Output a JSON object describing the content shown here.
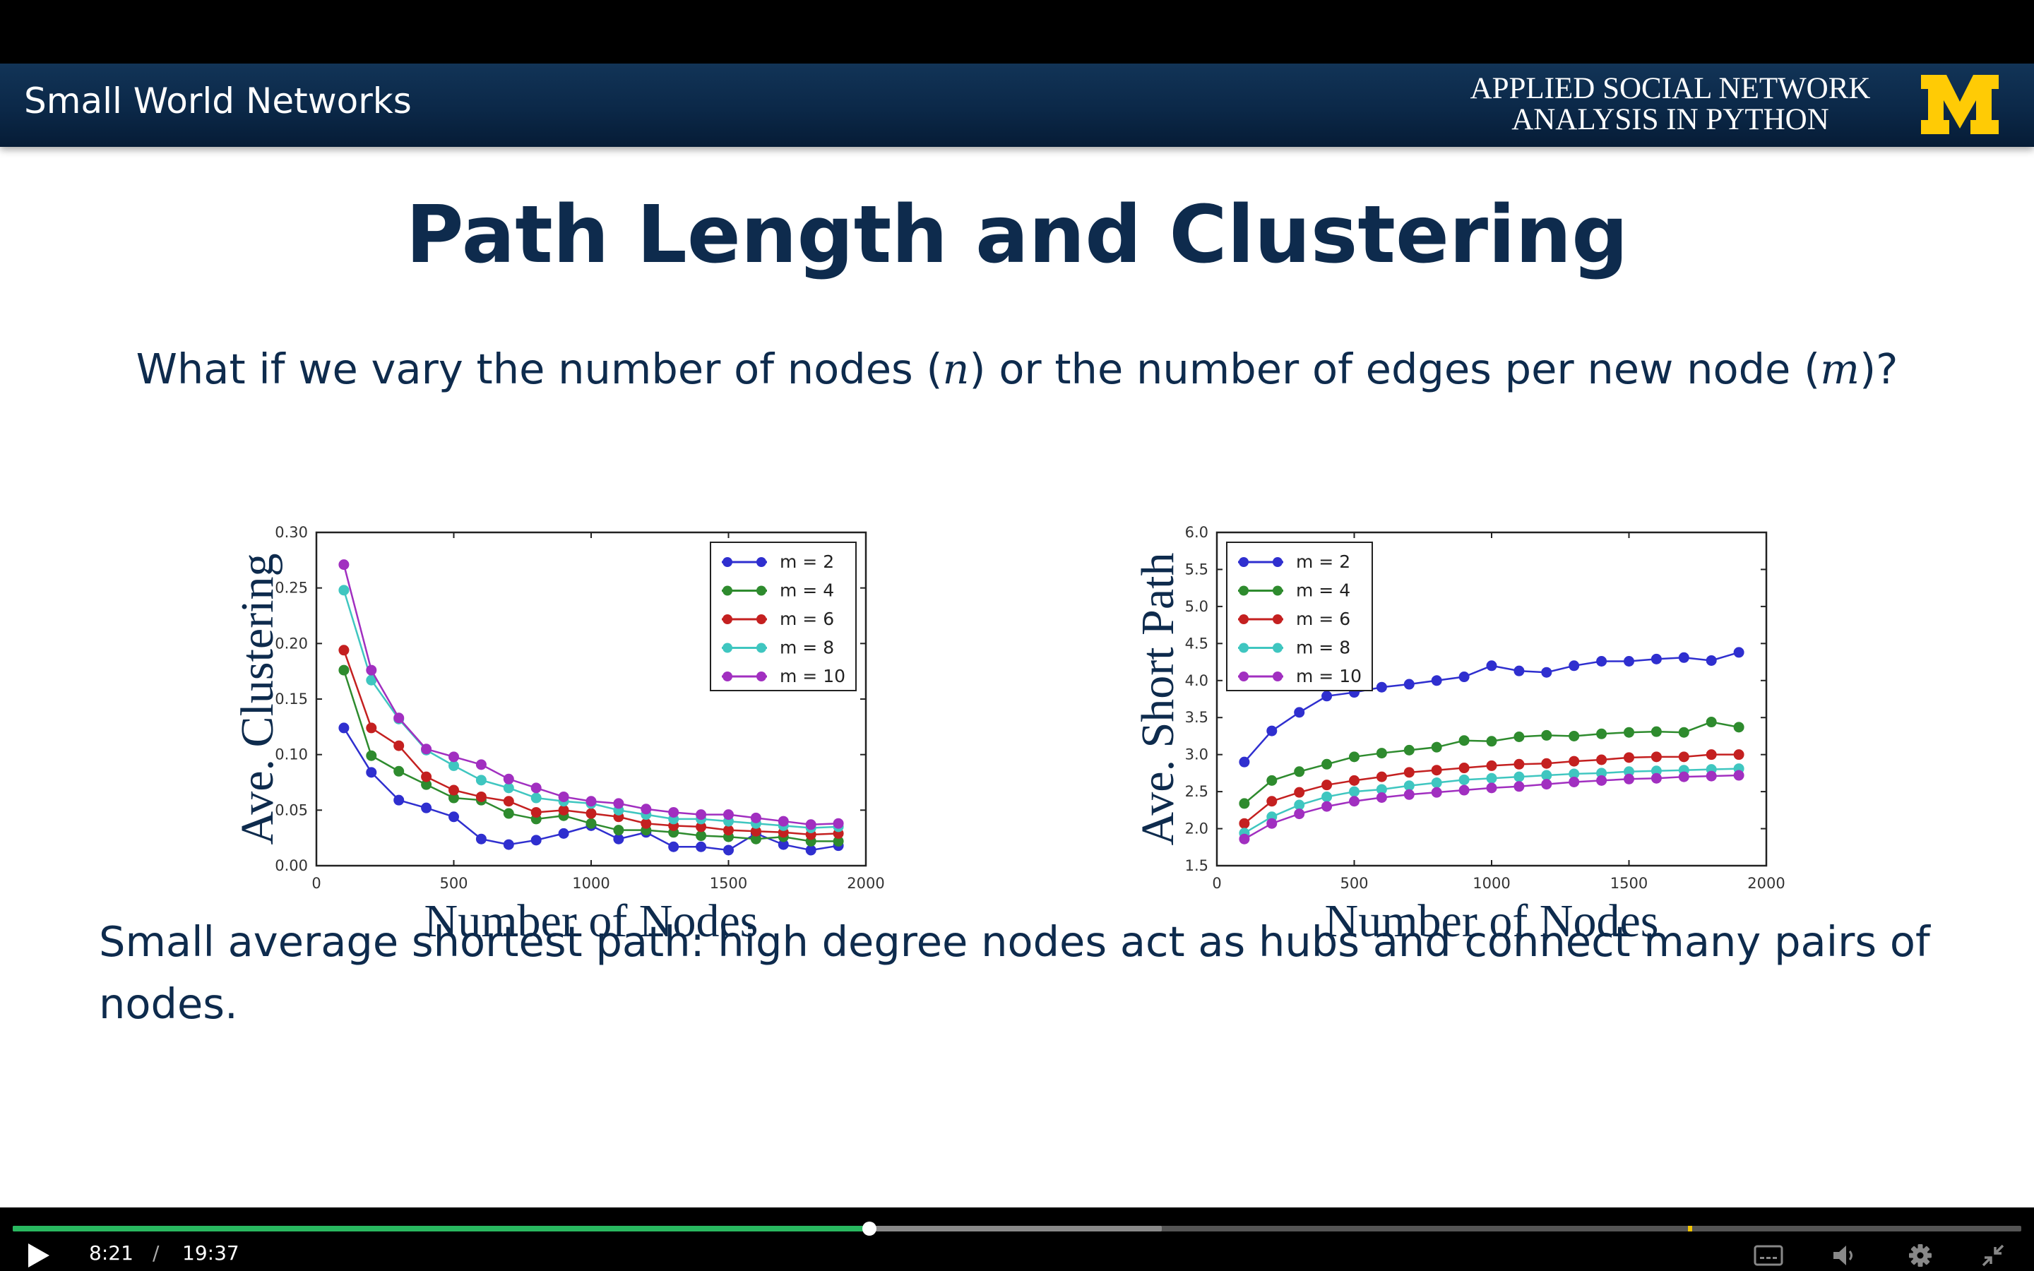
{
  "header": {
    "section_title": "Small World Networks",
    "course_line1": "APPLIED SOCIAL NETWORK",
    "course_line2": "ANALYSIS IN PYTHON",
    "logo": "block-m-logo"
  },
  "slide": {
    "title": "Path Length and Clustering",
    "question_part1": "What if we vary the number of nodes (",
    "question_var_n": "n",
    "question_part2": ") or the number of edges per new node (",
    "question_var_m": "m",
    "question_part3": ")?",
    "conclusion": "Small average shortest path: high degree nodes act as hubs and connect many pairs of nodes."
  },
  "player": {
    "current_time": "8:21",
    "separator": "/",
    "duration": "19:37",
    "progress_fraction": 0.4264,
    "buffered_fraction": 0.572,
    "marker_fraction": 0.834,
    "icons": [
      "play-icon",
      "captions-icon",
      "volume-icon",
      "settings-icon",
      "exit-fullscreen-icon"
    ]
  },
  "colors": {
    "header_bg": "#0b2848",
    "title_text": "#0e2b4d",
    "logo_yellow": "#ffcb05",
    "progress_played": "#29b860",
    "progress_marker": "#f4c500"
  },
  "chart_data": [
    {
      "type": "line",
      "xlabel": "Number of Nodes",
      "ylabel": "Ave. Clustering",
      "xlim": [
        0,
        2000
      ],
      "ylim": [
        0,
        0.3
      ],
      "xticks": [
        "0",
        "500",
        "1000",
        "1500",
        "2000"
      ],
      "yticks": [
        "0.00",
        "0.05",
        "0.10",
        "0.15",
        "0.20",
        "0.25",
        "0.30"
      ],
      "legend_position": "top-right",
      "x": [
        100,
        200,
        300,
        400,
        500,
        600,
        700,
        800,
        900,
        1000,
        1100,
        1200,
        1300,
        1400,
        1500,
        1600,
        1700,
        1800,
        1900
      ],
      "series": [
        {
          "name": "m = 2",
          "color": "#2f2fcf",
          "values": [
            0.124,
            0.084,
            0.059,
            0.052,
            0.044,
            0.024,
            0.019,
            0.023,
            0.029,
            0.036,
            0.024,
            0.03,
            0.017,
            0.017,
            0.014,
            0.029,
            0.019,
            0.014,
            0.018
          ]
        },
        {
          "name": "m = 4",
          "color": "#2e8b2e",
          "values": [
            0.176,
            0.099,
            0.085,
            0.073,
            0.061,
            0.059,
            0.047,
            0.042,
            0.045,
            0.038,
            0.032,
            0.032,
            0.03,
            0.027,
            0.026,
            0.024,
            0.026,
            0.022,
            0.022
          ]
        },
        {
          "name": "m = 6",
          "color": "#c42020",
          "values": [
            0.194,
            0.124,
            0.108,
            0.08,
            0.068,
            0.062,
            0.058,
            0.048,
            0.05,
            0.047,
            0.044,
            0.038,
            0.036,
            0.035,
            0.032,
            0.031,
            0.03,
            0.028,
            0.029
          ]
        },
        {
          "name": "m = 8",
          "color": "#3fc6c0",
          "values": [
            0.248,
            0.167,
            0.132,
            0.104,
            0.09,
            0.077,
            0.07,
            0.061,
            0.058,
            0.056,
            0.05,
            0.046,
            0.042,
            0.042,
            0.04,
            0.038,
            0.036,
            0.034,
            0.035
          ]
        },
        {
          "name": "m = 10",
          "color": "#a12fc0",
          "values": [
            0.271,
            0.176,
            0.133,
            0.105,
            0.098,
            0.091,
            0.078,
            0.07,
            0.062,
            0.058,
            0.056,
            0.051,
            0.048,
            0.046,
            0.046,
            0.043,
            0.04,
            0.037,
            0.038
          ]
        }
      ]
    },
    {
      "type": "line",
      "xlabel": "Number of Nodes",
      "ylabel": "Ave. Short Path",
      "xlim": [
        0,
        2000
      ],
      "ylim": [
        1.5,
        6.0
      ],
      "xticks": [
        "0",
        "500",
        "1000",
        "1500",
        "2000"
      ],
      "yticks": [
        "1.5",
        "2.0",
        "2.5",
        "3.0",
        "3.5",
        "4.0",
        "4.5",
        "5.0",
        "5.5",
        "6.0"
      ],
      "legend_position": "top-left",
      "x": [
        100,
        200,
        300,
        400,
        500,
        600,
        700,
        800,
        900,
        1000,
        1100,
        1200,
        1300,
        1400,
        1500,
        1600,
        1700,
        1800,
        1900
      ],
      "series": [
        {
          "name": "m = 2",
          "color": "#2f2fcf",
          "values": [
            2.9,
            3.32,
            3.57,
            3.79,
            3.84,
            3.91,
            3.95,
            4.0,
            4.05,
            4.2,
            4.13,
            4.11,
            4.2,
            4.26,
            4.26,
            4.29,
            4.31,
            4.27,
            4.38
          ]
        },
        {
          "name": "m = 4",
          "color": "#2e8b2e",
          "values": [
            2.34,
            2.65,
            2.77,
            2.87,
            2.97,
            3.02,
            3.06,
            3.1,
            3.19,
            3.18,
            3.24,
            3.26,
            3.25,
            3.28,
            3.3,
            3.31,
            3.3,
            3.44,
            3.37
          ]
        },
        {
          "name": "m = 6",
          "color": "#c42020",
          "values": [
            2.07,
            2.37,
            2.49,
            2.59,
            2.65,
            2.7,
            2.76,
            2.79,
            2.82,
            2.85,
            2.87,
            2.88,
            2.91,
            2.93,
            2.96,
            2.97,
            2.97,
            3.0,
            3.0
          ]
        },
        {
          "name": "m = 8",
          "color": "#3fc6c0",
          "values": [
            1.94,
            2.16,
            2.32,
            2.43,
            2.5,
            2.53,
            2.58,
            2.62,
            2.66,
            2.68,
            2.7,
            2.72,
            2.74,
            2.75,
            2.77,
            2.78,
            2.79,
            2.8,
            2.81
          ]
        },
        {
          "name": "m = 10",
          "color": "#a12fc0",
          "values": [
            1.86,
            2.07,
            2.2,
            2.3,
            2.37,
            2.42,
            2.46,
            2.49,
            2.52,
            2.55,
            2.57,
            2.6,
            2.63,
            2.65,
            2.67,
            2.68,
            2.7,
            2.71,
            2.72
          ]
        }
      ]
    }
  ]
}
